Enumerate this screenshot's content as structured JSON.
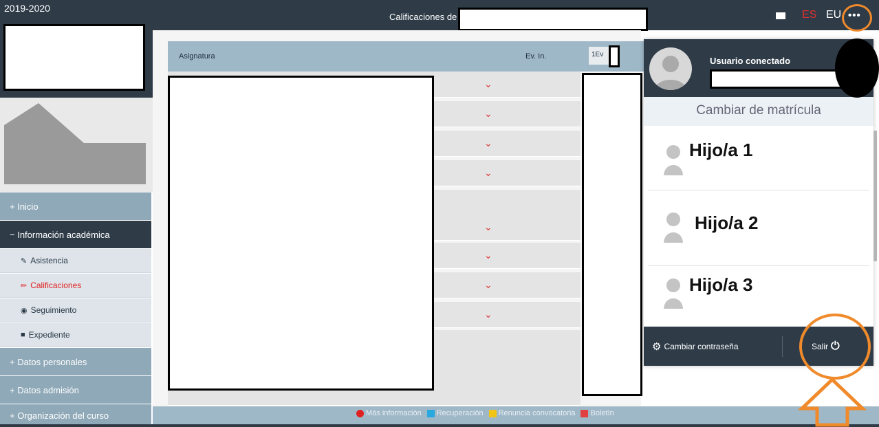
{
  "topbar": {
    "year": "2019-2020",
    "title": "Calificaciones de",
    "lang_es": "ES",
    "lang_eu": "EU",
    "more": "•••"
  },
  "sidebar": {
    "items": [
      {
        "label": "+ Inicio"
      },
      {
        "label": "− Información académica"
      },
      {
        "label": "Asistencia",
        "icon": "edit-icon"
      },
      {
        "label": "Calificaciones",
        "icon": "pencil-icon"
      },
      {
        "label": "Seguimiento",
        "icon": "eye-icon"
      },
      {
        "label": "Expediente",
        "icon": "folder-icon"
      },
      {
        "label": "+ Datos personales"
      },
      {
        "label": "+ Datos admisión"
      },
      {
        "label": "+ Organización del curso"
      }
    ]
  },
  "grades": {
    "col_subject": "Asignatura",
    "col_initial": "Ev. In.",
    "col_first": "1Ev"
  },
  "footer": {
    "mas_info": "Más información",
    "recuperacion": "Recuperación",
    "renuncia": "Renuncia convocatoria",
    "boletin": "Boletín"
  },
  "panel": {
    "user_label": "Usuario conectado",
    "switch_title": "Cambiar de matrícula",
    "children": [
      "Hijo/a 1",
      "Hijo/a 2",
      "Hijo/a 3"
    ],
    "change_password": "Cambiar contraseña",
    "logout": "Salir"
  },
  "colors": {
    "dark": "#2f3c48",
    "steel": "#8fa9b8",
    "accent_red": "#e03030",
    "annotation_orange": "#f08a2a"
  }
}
